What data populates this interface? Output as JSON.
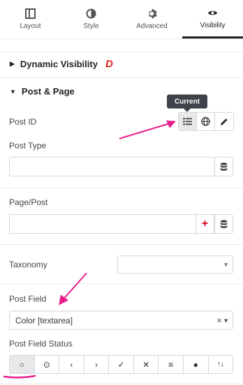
{
  "tabs": [
    {
      "label": "Layout",
      "icon": "layout-icon"
    },
    {
      "label": "Style",
      "icon": "style-half-circle-icon"
    },
    {
      "label": "Advanced",
      "icon": "gear-icon"
    },
    {
      "label": "Visibility",
      "icon": "eye-icon"
    }
  ],
  "active_tab": "Visibility",
  "sections": {
    "dynamic_visibility": {
      "title": "Dynamic Visibility",
      "badge": "D",
      "badge_color": "#e2231a"
    },
    "post_page": {
      "title": "Post & Page"
    }
  },
  "tooltip": {
    "text": "Current"
  },
  "fields": {
    "post_id": {
      "label": "Post ID",
      "buttons": [
        "list-icon",
        "globe-icon",
        "pencil-icon"
      ],
      "active": "list-icon"
    },
    "post_type": {
      "label": "Post Type",
      "value": ""
    },
    "page_post": {
      "label": "Page/Post",
      "value": ""
    },
    "taxonomy": {
      "label": "Taxonomy",
      "value": ""
    },
    "post_field": {
      "label": "Post Field",
      "value": "Color [textarea]",
      "clear": "×"
    },
    "post_field_status": {
      "label": "Post Field Status",
      "options": [
        "○",
        "⊙",
        "‹",
        "›",
        "✓",
        "✕",
        "≡",
        "●",
        "↑↓"
      ],
      "active_index": 0
    }
  },
  "colors": {
    "accent": "#e91e8c",
    "plus": "#d0021b"
  }
}
